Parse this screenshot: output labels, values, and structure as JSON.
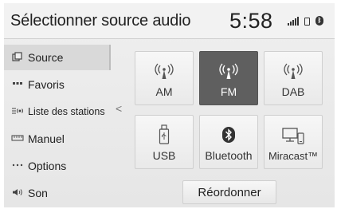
{
  "header": {
    "title": "Sélectionner source audio",
    "time": "5:58"
  },
  "sidebar": {
    "items": [
      {
        "label": "Source",
        "icon": "source-icon"
      },
      {
        "label": "Favoris",
        "icon": "favorites-icon"
      },
      {
        "label": "Liste des stations",
        "icon": "station-list-icon"
      },
      {
        "label": "Manuel",
        "icon": "manual-icon"
      },
      {
        "label": "Options",
        "icon": "options-icon"
      },
      {
        "label": "Son",
        "icon": "sound-icon"
      }
    ],
    "active_index": 0
  },
  "sources": [
    {
      "label": "AM",
      "icon": "antenna-icon"
    },
    {
      "label": "FM",
      "icon": "antenna-icon",
      "selected": true
    },
    {
      "label": "DAB",
      "icon": "antenna-icon"
    },
    {
      "label": "USB",
      "icon": "usb-icon"
    },
    {
      "label": "Bluetooth",
      "icon": "bluetooth-icon"
    },
    {
      "label": "Miracast™",
      "icon": "miracast-icon"
    }
  ],
  "reorder_label": "Réordonner",
  "colors": {
    "selected_tile": "#5f5f5f",
    "background": "#e9e9e9"
  }
}
